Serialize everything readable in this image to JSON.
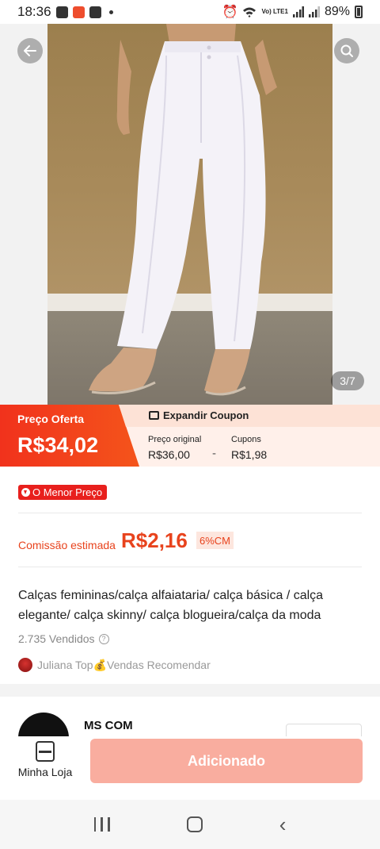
{
  "status_bar": {
    "time": "18:36",
    "network_label": "Vo) LTE1",
    "battery": "89%"
  },
  "gallery": {
    "counter": "3/7",
    "back_icon": "arrow-left-icon",
    "search_icon": "search-icon"
  },
  "price": {
    "offer_label": "Preço Oferta",
    "offer_price": "R$34,02",
    "expand_coupon": "Expandir Coupon",
    "original_label": "Preço original",
    "original_value": "R$36,00",
    "minus": "-",
    "coupons_label": "Cupons",
    "coupons_value": "R$1,98"
  },
  "badge": {
    "lowest_price": "O Menor Preço"
  },
  "commission": {
    "label": "Comissão estimada",
    "value": "R$2,16",
    "percent": "6%CM"
  },
  "product": {
    "title": "Calças femininas/calça alfaiataria/ calça básica / calça elegante/ calça skinny/ calça blogueira/calça da moda",
    "sold": "2.735 Vendidos",
    "recommend": "Juliana Top💰Vendas Recomendar"
  },
  "shop": {
    "name": "MS COM"
  },
  "bottom_bar": {
    "store_label": "Minha Loja",
    "add_label": "Adicionado"
  },
  "colors": {
    "accent": "#ee4d2d",
    "button_disabled": "#f9ad9f"
  }
}
